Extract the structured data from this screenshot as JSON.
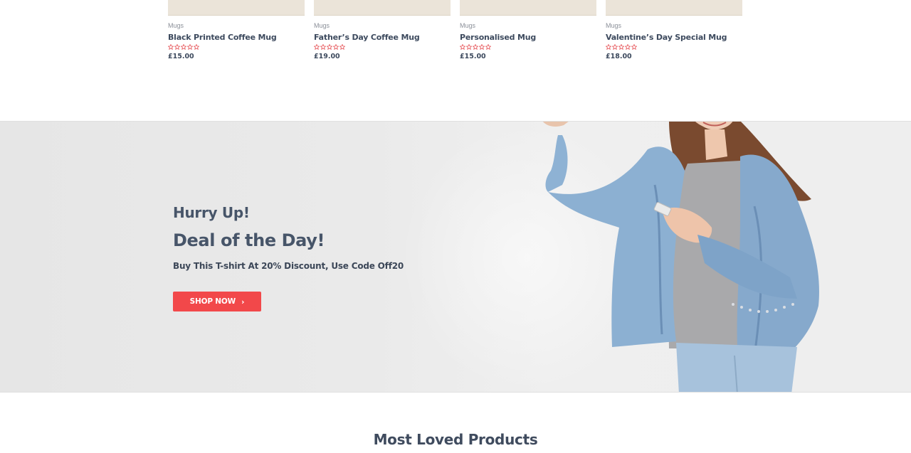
{
  "products": [
    {
      "category": "Mugs",
      "title": "Black Printed Coffee Mug",
      "price": "£15.00",
      "rating": 0
    },
    {
      "category": "Mugs",
      "title": "Father’s Day Coffee Mug",
      "price": "£19.00",
      "rating": 0
    },
    {
      "category": "Mugs",
      "title": "Personalised Mug",
      "price": "£15.00",
      "rating": 0
    },
    {
      "category": "Mugs",
      "title": "Valentine’s Day Special Mug",
      "price": "£18.00",
      "rating": 0
    }
  ],
  "banner": {
    "eyebrow": "Hurry Up!",
    "heading": "Deal of the Day!",
    "text": "Buy This T-shirt At 20% Discount, Use Code Off20",
    "button_label": "SHOP NOW",
    "button_icon": "chevron-right-icon",
    "button_color": "#f2484a"
  },
  "section": {
    "title": "Most Loved Products"
  },
  "colors": {
    "star_outline": "#e5484d",
    "text_dark": "#3f4b5e",
    "banner_bg": "#eaeaea"
  }
}
